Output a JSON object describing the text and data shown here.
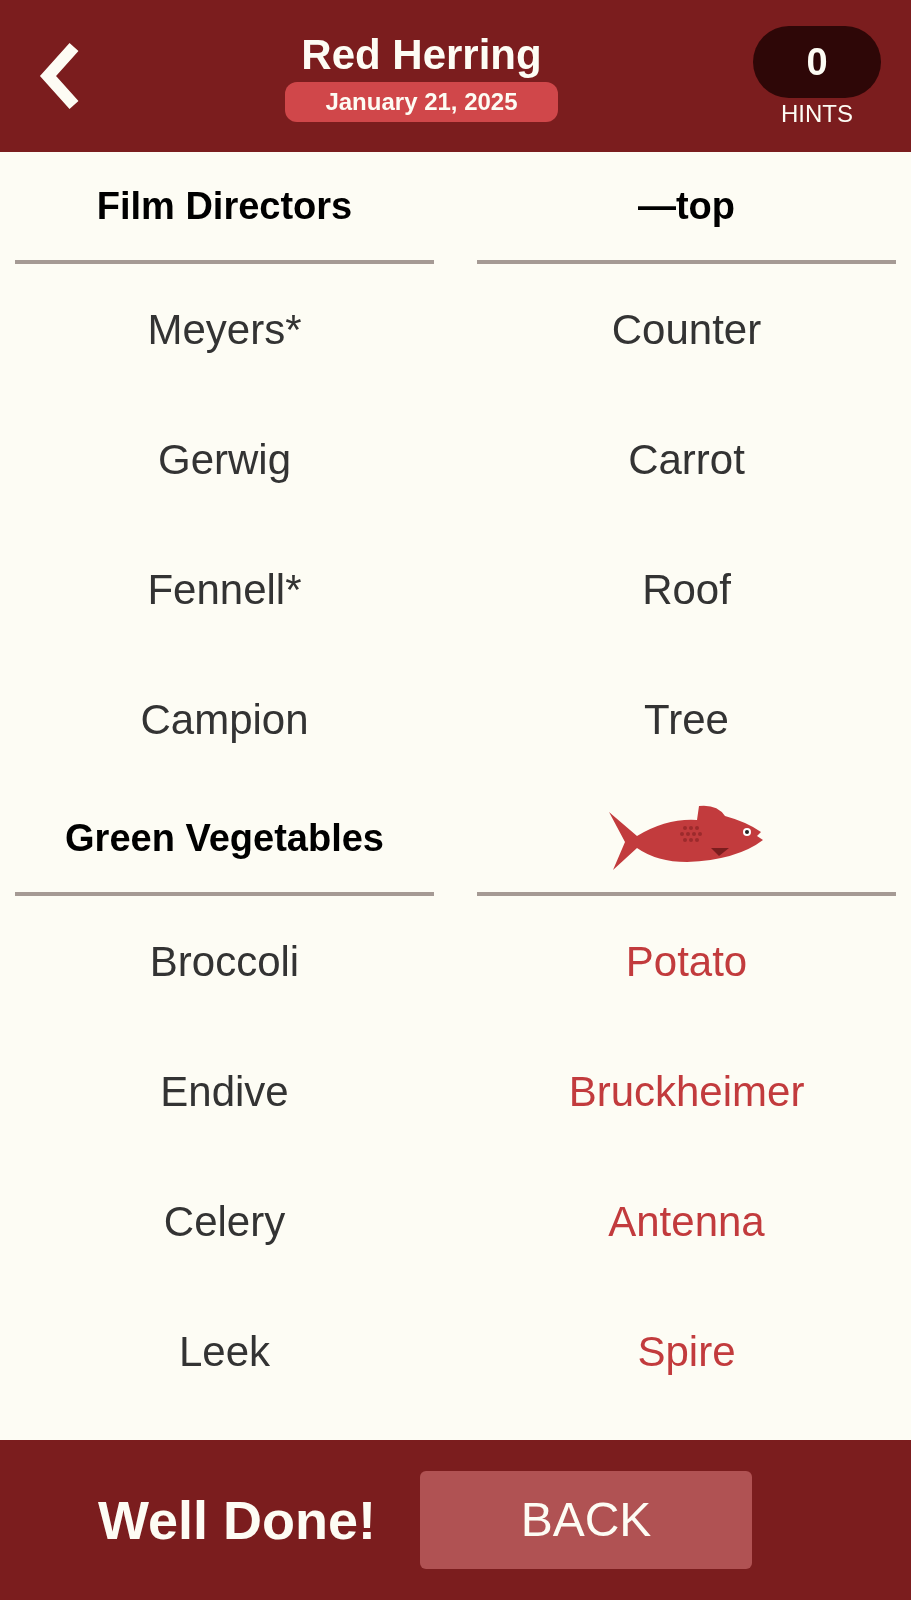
{
  "header": {
    "title": "Red Herring",
    "date": "January 21, 2025",
    "hints": {
      "count": "0",
      "label": "HINTS"
    }
  },
  "groups": [
    {
      "columns": [
        {
          "header": {
            "kind": "text",
            "text": "Film Directors"
          },
          "words": [
            {
              "text": "Meyers*",
              "highlighted": false
            },
            {
              "text": "Gerwig",
              "highlighted": false
            },
            {
              "text": "Fennell*",
              "highlighted": false
            },
            {
              "text": "Campion",
              "highlighted": false
            }
          ]
        },
        {
          "header": {
            "kind": "text",
            "text": "—top"
          },
          "words": [
            {
              "text": "Counter",
              "highlighted": false
            },
            {
              "text": "Carrot",
              "highlighted": false
            },
            {
              "text": "Roof",
              "highlighted": false
            },
            {
              "text": "Tree",
              "highlighted": false
            }
          ]
        }
      ]
    },
    {
      "columns": [
        {
          "header": {
            "kind": "text",
            "text": "Green Vegetables"
          },
          "words": [
            {
              "text": "Broccoli",
              "highlighted": false
            },
            {
              "text": "Endive",
              "highlighted": false
            },
            {
              "text": "Celery",
              "highlighted": false
            },
            {
              "text": "Leek",
              "highlighted": false
            }
          ]
        },
        {
          "header": {
            "kind": "fish"
          },
          "words": [
            {
              "text": "Potato",
              "highlighted": true
            },
            {
              "text": "Bruckheimer",
              "highlighted": true
            },
            {
              "text": "Antenna",
              "highlighted": true
            },
            {
              "text": "Spire",
              "highlighted": true
            }
          ]
        }
      ]
    }
  ],
  "footer": {
    "message": "Well Done!",
    "button": "BACK"
  }
}
